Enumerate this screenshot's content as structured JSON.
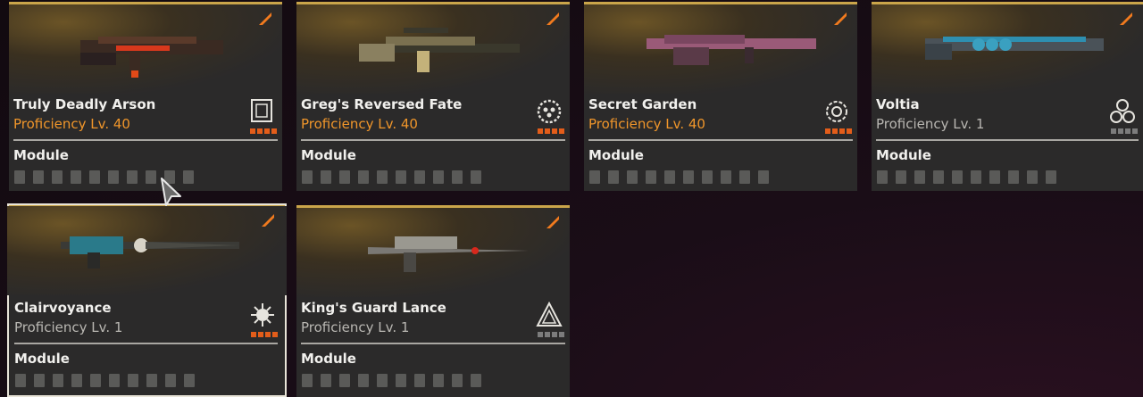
{
  "cards": [
    {
      "name": "Truly Deadly Arson",
      "proficiency": "Proficiency Lv. 40",
      "module": "Module",
      "emblem_icon": "shield-grid-emblem-icon",
      "stars": 4
    },
    {
      "name": "Greg's Reversed Fate",
      "proficiency": "Proficiency Lv. 40",
      "module": "Module",
      "emblem_icon": "gear-circle-emblem-icon",
      "stars": 4
    },
    {
      "name": "Secret Garden",
      "proficiency": "Proficiency Lv. 40",
      "module": "Module",
      "emblem_icon": "rose-emblem-icon",
      "stars": 4
    },
    {
      "name": "Voltia",
      "proficiency": "Proficiency Lv. 1",
      "module": "Module",
      "emblem_icon": "triple-circle-emblem-icon",
      "stars": 0
    },
    {
      "name": "Clairvoyance",
      "proficiency": "Proficiency Lv. 1",
      "module": "Module",
      "emblem_icon": "spiked-orb-emblem-icon",
      "stars": 4
    },
    {
      "name": "King's Guard Lance",
      "proficiency": "Proficiency Lv. 1",
      "module": "Module",
      "emblem_icon": "triangle-emblem-icon",
      "stars": 0
    }
  ],
  "colors": {
    "accent_gold": "#caa54a",
    "proficiency_max": "#f0962a",
    "proficiency_low": "#b9b7b2",
    "star_on": "#e35d1a",
    "star_off": "#7c7c7c",
    "badge": "#f07a1e"
  },
  "module_slots": 10
}
